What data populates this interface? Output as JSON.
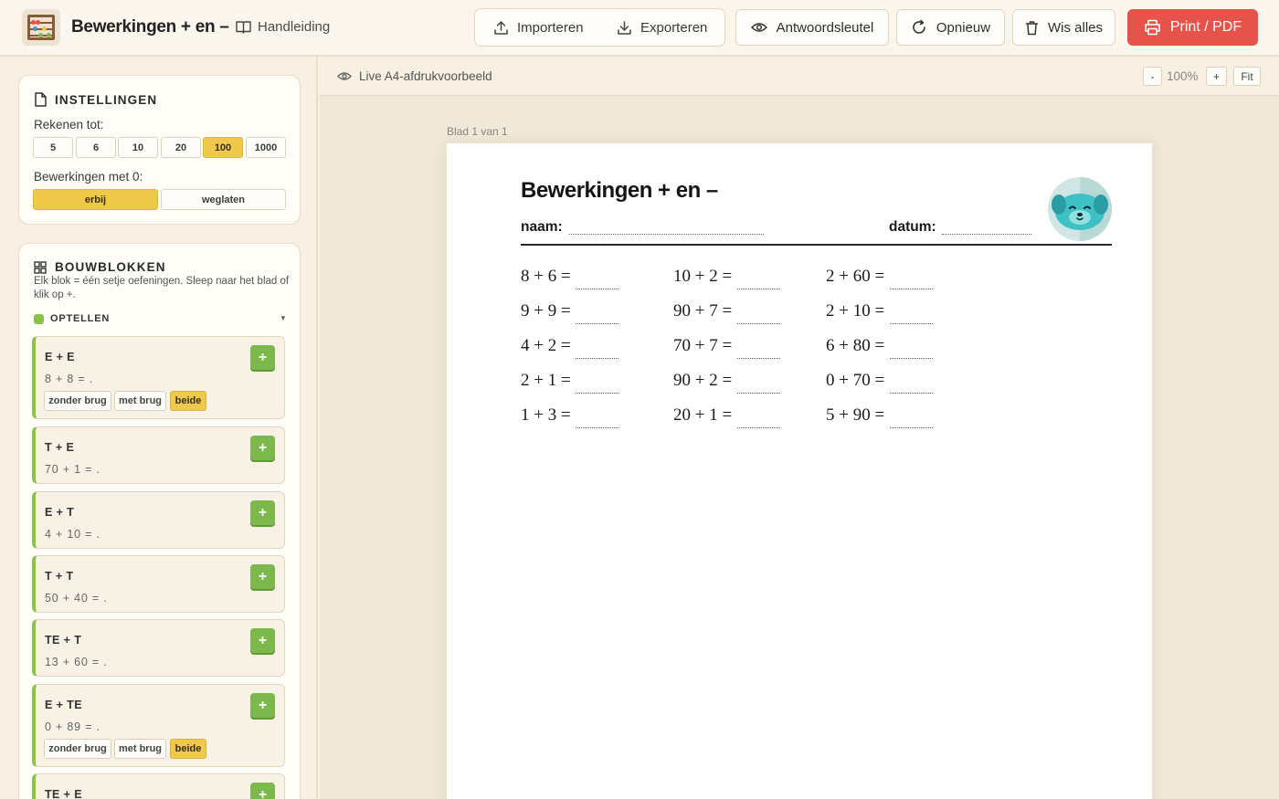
{
  "header": {
    "app_title": "Bewerkingen + en –",
    "manual_label": "Handleiding",
    "import_label": "Importeren",
    "export_label": "Exporteren",
    "answer_key_label": "Antwoordsleutel",
    "restart_label": "Opnieuw",
    "clear_label": "Wis alles",
    "print_label": "Print / PDF"
  },
  "settings": {
    "title": "INSTELLINGEN",
    "range_label": "Rekenen tot:",
    "range_options": [
      "5",
      "6",
      "10",
      "20",
      "100",
      "1000"
    ],
    "range_selected": "100",
    "zero_label": "Bewerkingen met 0:",
    "zero_options": [
      "erbij",
      "weglaten"
    ],
    "zero_selected": "erbij"
  },
  "blocks": {
    "title": "BOUWBLOKKEN",
    "hint": "Elk blok = één setje oefeningen. Sleep naar het blad of klik op +.",
    "section": "OPTELLEN",
    "add_symbol": "+",
    "chevron": "▾",
    "items": [
      {
        "name": "E + E",
        "example": "8 + 8 = .",
        "chips": [
          "zonder brug",
          "met brug",
          "beide"
        ],
        "chip_selected": "beide"
      },
      {
        "name": "T + E",
        "example": "70 + 1 = ."
      },
      {
        "name": "E + T",
        "example": "4 + 10 = ."
      },
      {
        "name": "T + T",
        "example": "50 + 40 = ."
      },
      {
        "name": "TE + T",
        "example": "13 + 60 = ."
      },
      {
        "name": "E + TE",
        "example": "0 + 89 = .",
        "chips": [
          "zonder brug",
          "met brug",
          "beide"
        ],
        "chip_selected": "beide"
      },
      {
        "name": "TE + E",
        "example": ""
      }
    ]
  },
  "preview": {
    "label": "Live A4-afdrukvoorbeeld",
    "zoom_out": "-",
    "zoom": "100%",
    "zoom_in": "+",
    "fit": "Fit",
    "sheet_label": "Blad 1 van 1"
  },
  "worksheet": {
    "title": "Bewerkingen + en –",
    "name_label": "naam:",
    "date_label": "datum:",
    "columns": [
      [
        "8 + 6 =",
        "9 + 9 =",
        "4 + 2 =",
        "2 + 1 =",
        "1 + 3 ="
      ],
      [
        "10 + 2 =",
        "90 + 7 =",
        "70 + 7 =",
        "90 + 2 =",
        "20 + 1 ="
      ],
      [
        "2 + 60 =",
        "2 + 10 =",
        "6 + 80 =",
        "0 + 70 =",
        "5 + 90 ="
      ]
    ]
  },
  "colors": {
    "accent_yellow": "#efc94c",
    "add_green": "#7cb84c",
    "print_red": "#e5534b",
    "background": "#f6efe2"
  }
}
